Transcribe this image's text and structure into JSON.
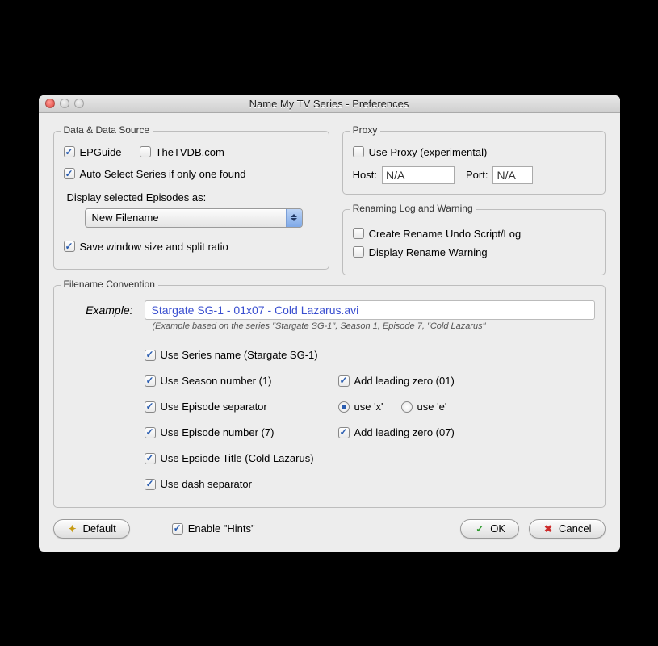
{
  "window": {
    "title": "Name My TV Series - Preferences"
  },
  "groups": {
    "dataSource": "Data & Data Source",
    "proxy": "Proxy",
    "renaming": "Renaming Log and Warning",
    "filename": "Filename Convention"
  },
  "dataSource": {
    "epguide": "EPGuide",
    "thetvdb": "TheTVDB.com",
    "autoSelect": "Auto Select Series if only one found",
    "displayAsLabel": "Display selected Episodes as:",
    "displayAsValue": "New Filename",
    "saveWindow": "Save window size and split ratio"
  },
  "proxy": {
    "useProxy": "Use Proxy (experimental)",
    "hostLabel": "Host:",
    "hostValue": "N/A",
    "portLabel": "Port:",
    "portValue": "N/A"
  },
  "renaming": {
    "createUndo": "Create Rename Undo Script/Log",
    "displayWarning": "Display Rename Warning"
  },
  "filename": {
    "exampleLabel": "Example:",
    "exampleValue": "Stargate SG-1 - 01x07 - Cold Lazarus.avi",
    "exampleNote": "(Example based on the series \"Stargate SG-1\", Season 1, Episode 7, \"Cold Lazarus\"",
    "useSeries": "Use Series name (Stargate SG-1)",
    "useSeason": "Use Season number (1)",
    "leadZeroSeason": "Add leading zero (01)",
    "useEpSep": "Use Episode separator",
    "radioX": "use 'x'",
    "radioE": "use 'e'",
    "useEpNum": "Use Episode number (7)",
    "leadZeroEp": "Add leading zero (07)",
    "useEpTitle": "Use Epsiode Title (Cold Lazarus)",
    "useDash": "Use dash separator"
  },
  "footer": {
    "default": "Default",
    "enableHints": "Enable \"Hints\"",
    "ok": "OK",
    "cancel": "Cancel"
  }
}
